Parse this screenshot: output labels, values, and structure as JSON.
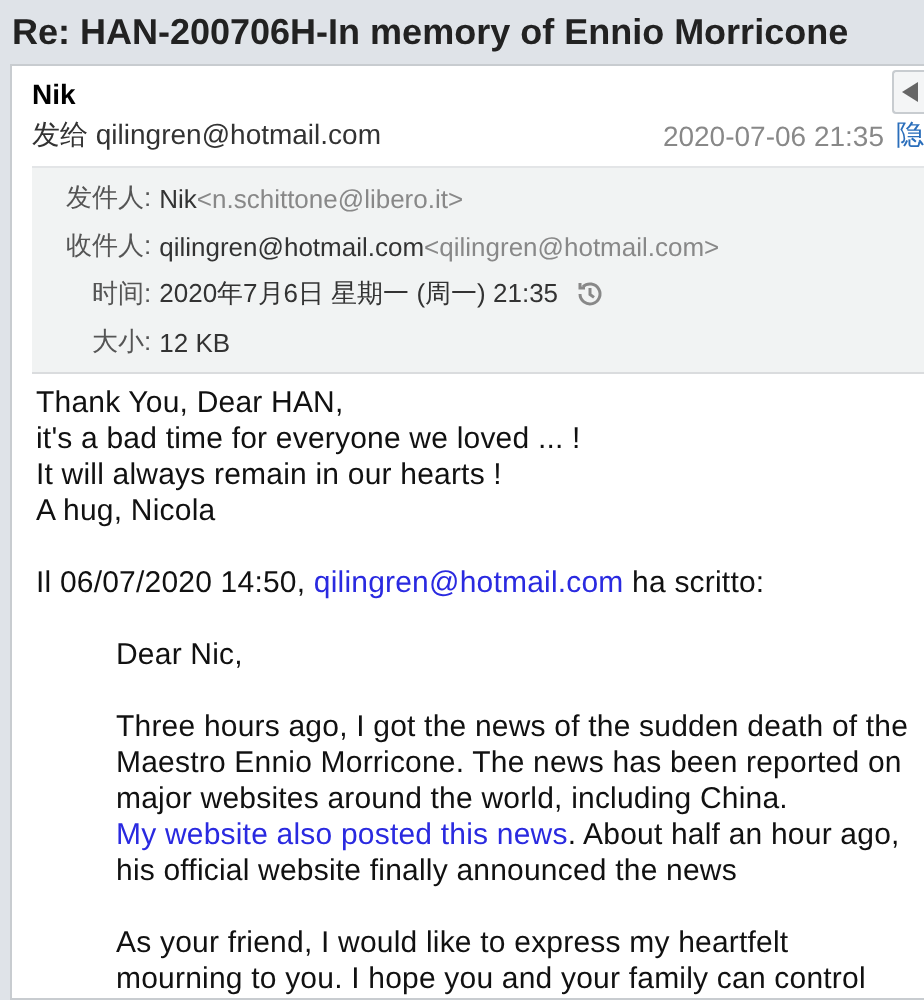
{
  "title": "Re: HAN-200706H-In memory of Ennio Morricone",
  "header": {
    "sender": "Nik",
    "to_label": "发给",
    "to": "qilingren@hotmail.com",
    "date": "2020-07-06 21:35",
    "hide_link": "隐"
  },
  "details": [
    {
      "kind": "address",
      "label": "发件人:",
      "name": "Nik",
      "address": "<n.schittone@libero.it>"
    },
    {
      "kind": "address",
      "label": "收件人:",
      "name": "qilingren@hotmail.com",
      "address": "<qilingren@hotmail.com>"
    },
    {
      "kind": "time",
      "label": "时间:",
      "value": "2020年7月6日 星期一 (周一) 21:35"
    },
    {
      "kind": "size",
      "label": "大小:",
      "value": "12 KB"
    }
  ],
  "body": {
    "lines": [
      "Thank You, Dear HAN,",
      "it's a bad time for everyone we loved ... !",
      "It will always remain in our hearts !",
      "A hug, Nicola"
    ],
    "quote_intro": [
      {
        "kind": "text",
        "text": "Il 06/07/2020 14:50, "
      },
      {
        "kind": "link",
        "text": "qilingren@hotmail.com"
      },
      {
        "kind": "text",
        "text": " ha scritto:"
      }
    ],
    "quoted": [
      [
        {
          "kind": "text",
          "text": "Dear Nic,"
        }
      ],
      [
        {
          "kind": "text",
          "text": "Three hours ago, I got the news of the sudden death of the Maestro Ennio Morricone. The news has been reported on major websites around the world, including China. "
        },
        {
          "kind": "link",
          "text": "My website also posted this news"
        },
        {
          "kind": "text",
          "text": ". About half an hour ago, his official website finally announced the news"
        }
      ],
      [
        {
          "kind": "text",
          "text": "As your friend, I would like to express my heartfelt mourning to you. I hope you and your family can control"
        }
      ]
    ]
  }
}
